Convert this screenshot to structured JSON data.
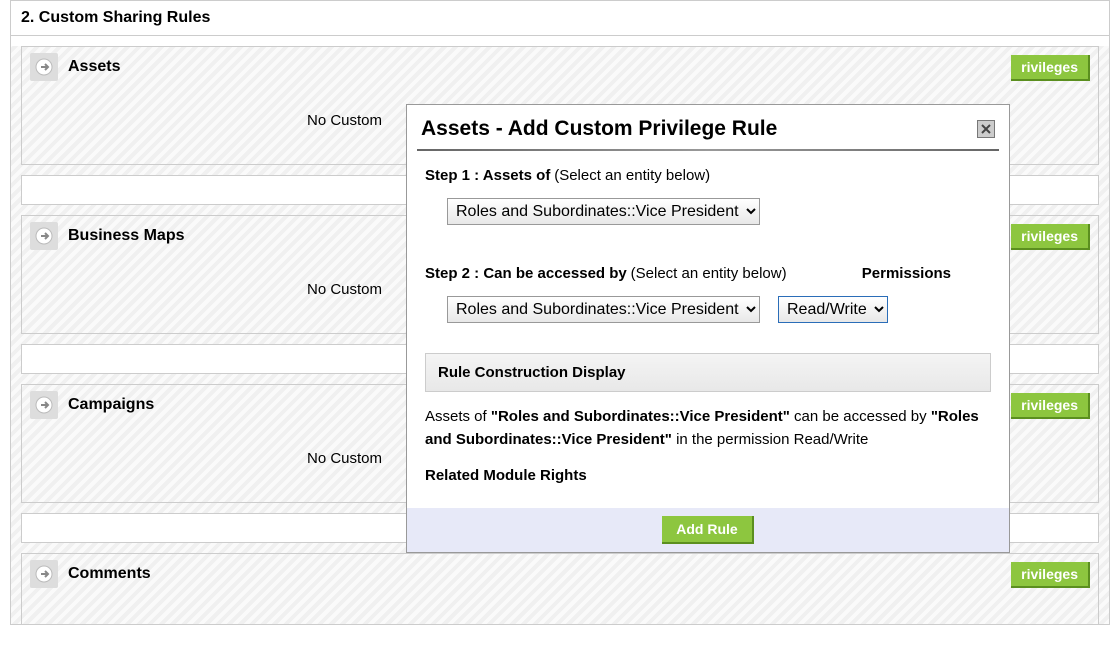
{
  "panel": {
    "title": "2. Custom Sharing Rules"
  },
  "modules": [
    {
      "name": "Assets",
      "body": "No Custom",
      "button": "rivileges"
    },
    {
      "name": "Business Maps",
      "body": "No Custom",
      "button": "rivileges"
    },
    {
      "name": "Campaigns",
      "body": "No Custom",
      "button": "rivileges"
    },
    {
      "name": "Comments",
      "body": "",
      "button": "rivileges"
    }
  ],
  "modal": {
    "title": "Assets - Add Custom Privilege Rule",
    "step1_label": "Step 1 : Assets of",
    "step1_hint": "(Select an entity below)",
    "step1_select_value": "Roles and Subordinates::Vice President",
    "step2_label": "Step 2 : Can be accessed by",
    "step2_hint": "(Select an entity below)",
    "permissions_label": "Permissions",
    "step2_select_value": "Roles and Subordinates::Vice President",
    "perm_select_value": "Read/Write",
    "rule_display_header": "Rule Construction Display",
    "rule_text_prefix": "Assets of ",
    "rule_text_entity1": "\"Roles and Subordinates::Vice President\"",
    "rule_text_mid": " can be accessed by ",
    "rule_text_entity2": "\"Roles and Subordinates::Vice President\"",
    "rule_text_suffix": " in the permission Read/Write",
    "related_label": "Related Module Rights",
    "add_rule_button": "Add Rule"
  }
}
